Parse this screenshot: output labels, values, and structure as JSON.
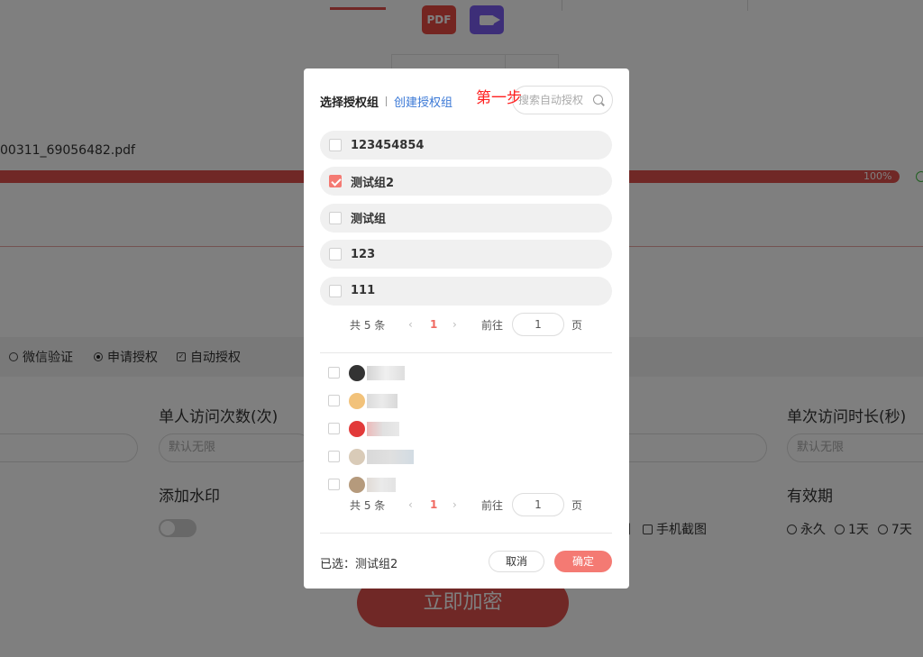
{
  "background": {
    "format_icons": {
      "pdf": "PDF"
    },
    "file_name": "00311_69056482.pdf",
    "progress": {
      "percent": 100,
      "label": "100%"
    },
    "auth_options": [
      {
        "label": "微信验证",
        "type": "radio",
        "selected": false
      },
      {
        "label": "申请授权",
        "type": "radio",
        "selected": true
      },
      {
        "label": "自动授权",
        "type": "checkbox",
        "checked": true
      }
    ],
    "fields": {
      "single_visits_label": "单人访问次数(次)",
      "single_visits_placeholder": "默认无限",
      "single_duration_label": "单次访问时长(秒)",
      "single_duration_placeholder": "默认无限",
      "watermark_label": "添加水印",
      "validity_label": "有效期"
    },
    "screenshot_options": {
      "partial": "图",
      "phone": "手机截图"
    },
    "validity_options": [
      "永久",
      "1天",
      "7天"
    ],
    "encrypt_button": "立即加密"
  },
  "modal": {
    "title": "选择授权组",
    "create_link": "创建授权组",
    "annotation": "第一步",
    "search_placeholder": "搜索自动授权",
    "groups": [
      {
        "name": "123454854",
        "checked": false
      },
      {
        "name": "测试组2",
        "checked": true
      },
      {
        "name": "测试组",
        "checked": false
      },
      {
        "name": "123",
        "checked": false
      },
      {
        "name": "111",
        "checked": false
      }
    ],
    "group_pager": {
      "total": "共 5 条",
      "current": "1",
      "goto_label": "前往",
      "goto_value": "1",
      "unit": "页"
    },
    "users": [
      {
        "avatar_color": "#333333",
        "checked": false
      },
      {
        "avatar_color": "#f2c27a",
        "checked": false
      },
      {
        "avatar_color": "#e23a3a",
        "checked": false
      },
      {
        "avatar_color": "#d9cbb8",
        "checked": false
      },
      {
        "avatar_color": "#b59a7c",
        "checked": false
      }
    ],
    "user_pager": {
      "total": "共 5 条",
      "current": "1",
      "goto_label": "前往",
      "goto_value": "1",
      "unit": "页"
    },
    "selected_text": "已选：测试组2",
    "cancel_label": "取消",
    "confirm_label": "确定"
  },
  "colors": {
    "accent": "#e0504c",
    "modal_accent": "#f47a73",
    "link": "#3a78d6",
    "annotation": "#ff2020"
  }
}
